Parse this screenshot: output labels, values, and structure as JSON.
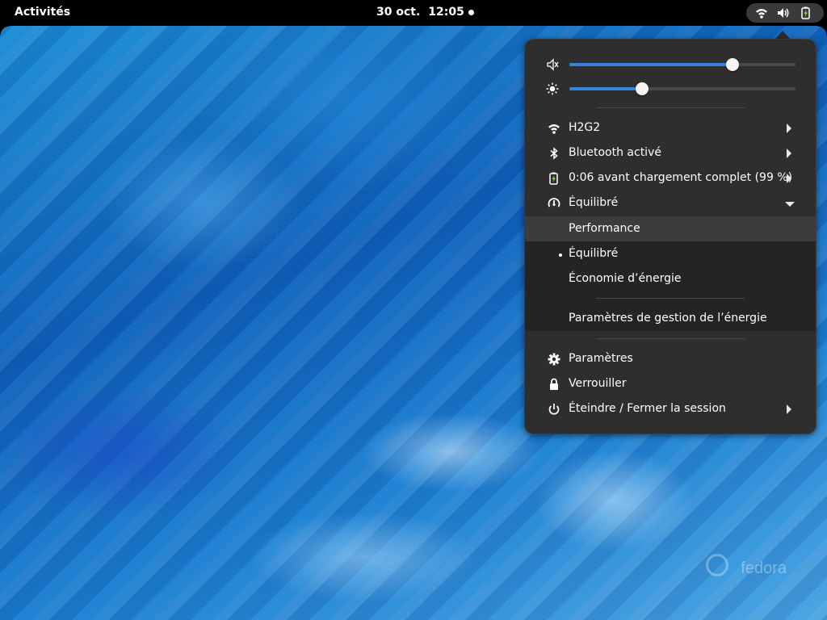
{
  "topbar": {
    "activities": "Activités",
    "date": "30 oct.",
    "time": "12:05"
  },
  "status_icons": [
    "wifi-icon",
    "volume-icon",
    "battery-charging-icon"
  ],
  "sliders": {
    "volume": {
      "icon": "volume-muted-icon",
      "level": 0.72
    },
    "brightness": {
      "icon": "brightness-icon",
      "level": 0.32
    }
  },
  "menu": {
    "wifi_label": "H2G2",
    "bluetooth_label": "Bluetooth activé",
    "battery_label": "0:06 avant chargement complet (99 %)",
    "power_mode_label": "Équilibré",
    "power_options": {
      "performance": "Performance",
      "balanced": "Équilibré",
      "power_saver": "Économie d’énergie"
    },
    "power_settings_label": "Paramètres de gestion de l’énergie",
    "settings_label": "Paramètres",
    "lock_label": "Verrouiller",
    "power_off_label": "Éteindre / Fermer la session"
  },
  "watermark": "fedora",
  "colors": {
    "accent": "#3584e4",
    "menu_bg": "#2e2e2e",
    "topbar_bg": "#000000"
  }
}
